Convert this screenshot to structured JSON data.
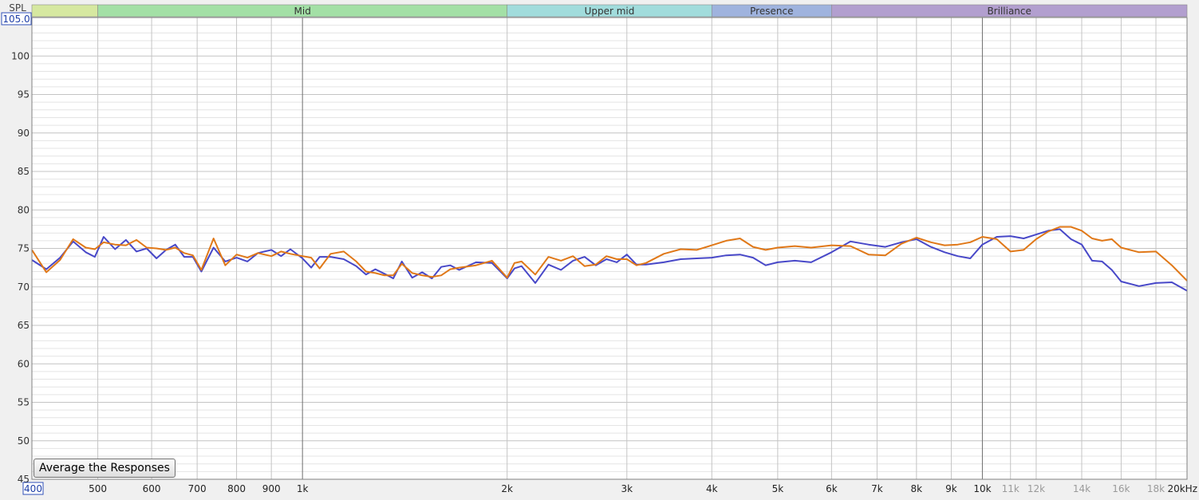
{
  "chart_data": {
    "type": "line",
    "ylabel": "SPL",
    "ylim": [
      45,
      105
    ],
    "y_top_readout": "105.0",
    "x_scale": "log",
    "xlim": [
      400,
      20000
    ],
    "x_unit": "Hz",
    "grid": true,
    "y_ticks": [
      {
        "value": 100,
        "label": "100"
      },
      {
        "value": 95,
        "label": "95"
      },
      {
        "value": 90,
        "label": "90"
      },
      {
        "value": 85,
        "label": "85"
      },
      {
        "value": 80,
        "label": "80"
      },
      {
        "value": 75,
        "label": "75"
      },
      {
        "value": 70,
        "label": "70"
      },
      {
        "value": 65,
        "label": "65"
      },
      {
        "value": 60,
        "label": "60"
      },
      {
        "value": 55,
        "label": "55"
      },
      {
        "value": 50,
        "label": "50"
      },
      {
        "value": 45,
        "label": "45"
      }
    ],
    "x_ticks": [
      {
        "value": 400,
        "label": "400",
        "boxed": true
      },
      {
        "value": 500,
        "label": "500"
      },
      {
        "value": 600,
        "label": "600"
      },
      {
        "value": 700,
        "label": "700"
      },
      {
        "value": 800,
        "label": "800"
      },
      {
        "value": 900,
        "label": "900"
      },
      {
        "value": 1000,
        "label": "1k"
      },
      {
        "value": 2000,
        "label": "2k"
      },
      {
        "value": 3000,
        "label": "3k"
      },
      {
        "value": 4000,
        "label": "4k"
      },
      {
        "value": 5000,
        "label": "5k"
      },
      {
        "value": 6000,
        "label": "6k"
      },
      {
        "value": 7000,
        "label": "7k"
      },
      {
        "value": 8000,
        "label": "8k"
      },
      {
        "value": 9000,
        "label": "9k"
      },
      {
        "value": 10000,
        "label": "10k"
      },
      {
        "value": 11000,
        "label": "11k",
        "faint": true
      },
      {
        "value": 12000,
        "label": "12k",
        "faint": true
      },
      {
        "value": 14000,
        "label": "14k",
        "faint": true
      },
      {
        "value": 16000,
        "label": "16k",
        "faint": true
      },
      {
        "value": 18000,
        "label": "18k",
        "faint": true
      },
      {
        "value": 20000,
        "label": "20kHz"
      }
    ],
    "bands": [
      {
        "label": "",
        "from": 400,
        "to": 500,
        "color": "#d6e8a0"
      },
      {
        "label": "Mid",
        "from": 500,
        "to": 2000,
        "color": "#a3e0a6"
      },
      {
        "label": "Upper mid",
        "from": 2000,
        "to": 4000,
        "color": "#a1dcdc"
      },
      {
        "label": "Presence",
        "from": 4000,
        "to": 6000,
        "color": "#9fb3de"
      },
      {
        "label": "Brilliance",
        "from": 6000,
        "to": 20000,
        "color": "#b29fcf"
      }
    ],
    "series": [
      {
        "color": "#4848c8",
        "points": [
          [
            400,
            73.5
          ],
          [
            420,
            72.3
          ],
          [
            440,
            73.8
          ],
          [
            460,
            75.9
          ],
          [
            480,
            74.5
          ],
          [
            495,
            73.9
          ],
          [
            510,
            76.5
          ],
          [
            530,
            74.9
          ],
          [
            550,
            76.1
          ],
          [
            570,
            74.6
          ],
          [
            590,
            75.0
          ],
          [
            610,
            73.7
          ],
          [
            630,
            74.8
          ],
          [
            650,
            75.5
          ],
          [
            670,
            73.9
          ],
          [
            690,
            73.9
          ],
          [
            710,
            72.0
          ],
          [
            740,
            75.1
          ],
          [
            770,
            73.3
          ],
          [
            800,
            73.8
          ],
          [
            830,
            73.3
          ],
          [
            860,
            74.4
          ],
          [
            900,
            74.8
          ],
          [
            930,
            74.0
          ],
          [
            960,
            74.9
          ],
          [
            1000,
            73.7
          ],
          [
            1030,
            72.5
          ],
          [
            1060,
            73.9
          ],
          [
            1100,
            73.9
          ],
          [
            1150,
            73.6
          ],
          [
            1200,
            72.7
          ],
          [
            1240,
            71.6
          ],
          [
            1280,
            72.3
          ],
          [
            1320,
            71.7
          ],
          [
            1360,
            71.1
          ],
          [
            1400,
            73.3
          ],
          [
            1450,
            71.2
          ],
          [
            1500,
            71.9
          ],
          [
            1550,
            71.1
          ],
          [
            1600,
            72.6
          ],
          [
            1650,
            72.8
          ],
          [
            1700,
            72.2
          ],
          [
            1800,
            73.2
          ],
          [
            1900,
            73.1
          ],
          [
            2000,
            71.1
          ],
          [
            2050,
            72.4
          ],
          [
            2100,
            72.7
          ],
          [
            2200,
            70.5
          ],
          [
            2300,
            72.9
          ],
          [
            2400,
            72.2
          ],
          [
            2500,
            73.4
          ],
          [
            2600,
            73.9
          ],
          [
            2700,
            72.8
          ],
          [
            2800,
            73.6
          ],
          [
            2900,
            73.2
          ],
          [
            3000,
            74.2
          ],
          [
            3100,
            72.9
          ],
          [
            3200,
            72.9
          ],
          [
            3400,
            73.2
          ],
          [
            3600,
            73.6
          ],
          [
            3800,
            73.7
          ],
          [
            4000,
            73.8
          ],
          [
            4200,
            74.1
          ],
          [
            4400,
            74.2
          ],
          [
            4600,
            73.8
          ],
          [
            4800,
            72.8
          ],
          [
            5000,
            73.2
          ],
          [
            5300,
            73.4
          ],
          [
            5600,
            73.2
          ],
          [
            6000,
            74.5
          ],
          [
            6400,
            75.9
          ],
          [
            6800,
            75.5
          ],
          [
            7200,
            75.2
          ],
          [
            7600,
            75.8
          ],
          [
            8000,
            76.2
          ],
          [
            8400,
            75.2
          ],
          [
            8800,
            74.5
          ],
          [
            9200,
            74.0
          ],
          [
            9600,
            73.7
          ],
          [
            10000,
            75.5
          ],
          [
            10500,
            76.5
          ],
          [
            11000,
            76.6
          ],
          [
            11500,
            76.3
          ],
          [
            12000,
            76.8
          ],
          [
            12500,
            77.3
          ],
          [
            13000,
            77.5
          ],
          [
            13500,
            76.2
          ],
          [
            14000,
            75.5
          ],
          [
            14500,
            73.4
          ],
          [
            15000,
            73.3
          ],
          [
            15500,
            72.2
          ],
          [
            16000,
            70.7
          ],
          [
            17000,
            70.1
          ],
          [
            18000,
            70.5
          ],
          [
            19000,
            70.6
          ],
          [
            20000,
            69.5
          ]
        ]
      },
      {
        "color": "#e07818",
        "points": [
          [
            400,
            74.8
          ],
          [
            420,
            71.9
          ],
          [
            440,
            73.5
          ],
          [
            460,
            76.2
          ],
          [
            480,
            75.1
          ],
          [
            495,
            74.9
          ],
          [
            510,
            75.8
          ],
          [
            530,
            75.5
          ],
          [
            550,
            75.4
          ],
          [
            570,
            76.1
          ],
          [
            590,
            75.1
          ],
          [
            610,
            75.0
          ],
          [
            630,
            74.8
          ],
          [
            650,
            75.1
          ],
          [
            670,
            74.4
          ],
          [
            690,
            74.1
          ],
          [
            710,
            72.2
          ],
          [
            740,
            76.3
          ],
          [
            770,
            72.8
          ],
          [
            800,
            74.2
          ],
          [
            830,
            73.8
          ],
          [
            860,
            74.4
          ],
          [
            900,
            74.0
          ],
          [
            930,
            74.6
          ],
          [
            960,
            74.3
          ],
          [
            1000,
            74.0
          ],
          [
            1030,
            73.8
          ],
          [
            1060,
            72.4
          ],
          [
            1100,
            74.3
          ],
          [
            1150,
            74.6
          ],
          [
            1200,
            73.3
          ],
          [
            1240,
            72.0
          ],
          [
            1280,
            71.8
          ],
          [
            1320,
            71.5
          ],
          [
            1360,
            71.5
          ],
          [
            1400,
            73.0
          ],
          [
            1450,
            71.8
          ],
          [
            1500,
            71.5
          ],
          [
            1550,
            71.3
          ],
          [
            1600,
            71.5
          ],
          [
            1650,
            72.3
          ],
          [
            1700,
            72.5
          ],
          [
            1800,
            72.8
          ],
          [
            1900,
            73.4
          ],
          [
            2000,
            71.2
          ],
          [
            2050,
            73.1
          ],
          [
            2100,
            73.3
          ],
          [
            2200,
            71.6
          ],
          [
            2300,
            73.9
          ],
          [
            2400,
            73.4
          ],
          [
            2500,
            74.0
          ],
          [
            2600,
            72.7
          ],
          [
            2700,
            72.9
          ],
          [
            2800,
            74.0
          ],
          [
            2900,
            73.6
          ],
          [
            3000,
            73.6
          ],
          [
            3100,
            72.8
          ],
          [
            3200,
            73.1
          ],
          [
            3400,
            74.3
          ],
          [
            3600,
            74.9
          ],
          [
            3800,
            74.8
          ],
          [
            4000,
            75.4
          ],
          [
            4200,
            76.0
          ],
          [
            4400,
            76.3
          ],
          [
            4600,
            75.2
          ],
          [
            4800,
            74.8
          ],
          [
            5000,
            75.1
          ],
          [
            5300,
            75.3
          ],
          [
            5600,
            75.1
          ],
          [
            6000,
            75.4
          ],
          [
            6400,
            75.3
          ],
          [
            6800,
            74.2
          ],
          [
            7200,
            74.1
          ],
          [
            7600,
            75.6
          ],
          [
            8000,
            76.4
          ],
          [
            8400,
            75.8
          ],
          [
            8800,
            75.4
          ],
          [
            9200,
            75.5
          ],
          [
            9600,
            75.8
          ],
          [
            10000,
            76.5
          ],
          [
            10500,
            76.2
          ],
          [
            11000,
            74.6
          ],
          [
            11500,
            74.8
          ],
          [
            12000,
            76.2
          ],
          [
            12500,
            77.2
          ],
          [
            13000,
            77.8
          ],
          [
            13500,
            77.8
          ],
          [
            14000,
            77.3
          ],
          [
            14500,
            76.3
          ],
          [
            15000,
            76.0
          ],
          [
            15500,
            76.2
          ],
          [
            16000,
            75.1
          ],
          [
            17000,
            74.5
          ],
          [
            18000,
            74.6
          ],
          [
            19000,
            72.8
          ],
          [
            20000,
            70.8
          ]
        ]
      }
    ]
  },
  "controls": {
    "average_label": "Average the Responses"
  }
}
